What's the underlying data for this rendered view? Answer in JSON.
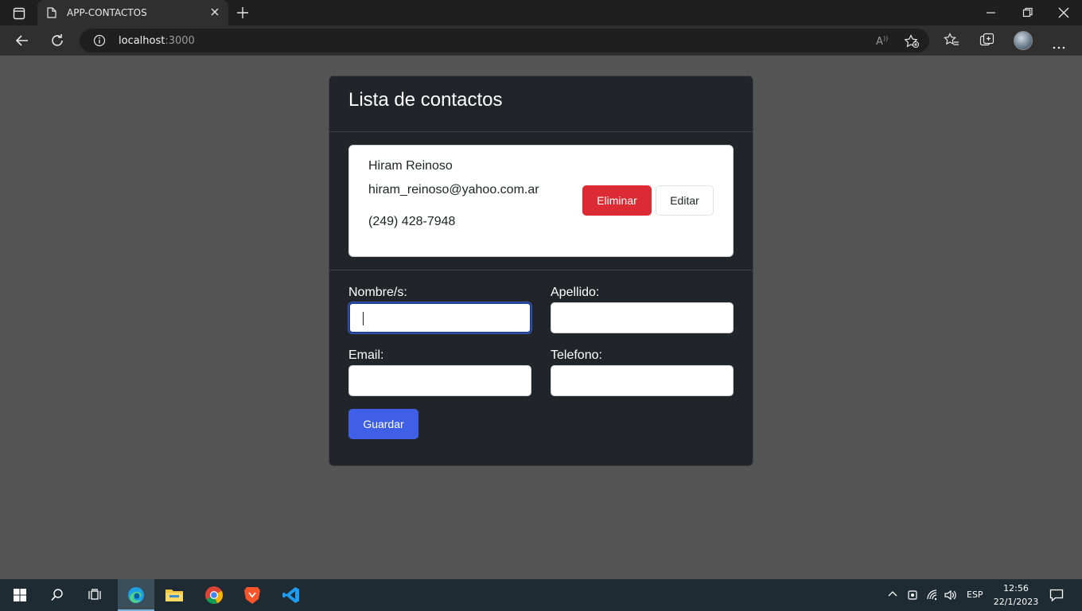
{
  "browser": {
    "tab_title": "APP-CONTACTOS",
    "url_host": "localhost",
    "url_port": ":3000"
  },
  "app": {
    "title": "Lista de contactos",
    "contacts": [
      {
        "name": "Hiram Reinoso",
        "email": "hiram_reinoso@yahoo.com.ar",
        "phone": "(249) 428-7948"
      }
    ],
    "delete_label": "Eliminar",
    "edit_label": "Editar",
    "form": {
      "first_name_label": "Nombre/s:",
      "last_name_label": "Apellido:",
      "email_label": "Email:",
      "phone_label": "Telefono:",
      "first_name_value": "",
      "last_name_value": "",
      "email_value": "",
      "phone_value": "",
      "save_label": "Guardar"
    },
    "colors": {
      "delete": "#dc2b34",
      "save": "#3e5fe6",
      "card_bg": "#212529",
      "page_bg": "#555555"
    }
  },
  "taskbar": {
    "language": "ESP",
    "time": "12:56",
    "date": "22/1/2023",
    "apps": [
      "edge-icon",
      "file-explorer-icon",
      "chrome-icon",
      "brave-icon",
      "vscode-icon"
    ]
  }
}
